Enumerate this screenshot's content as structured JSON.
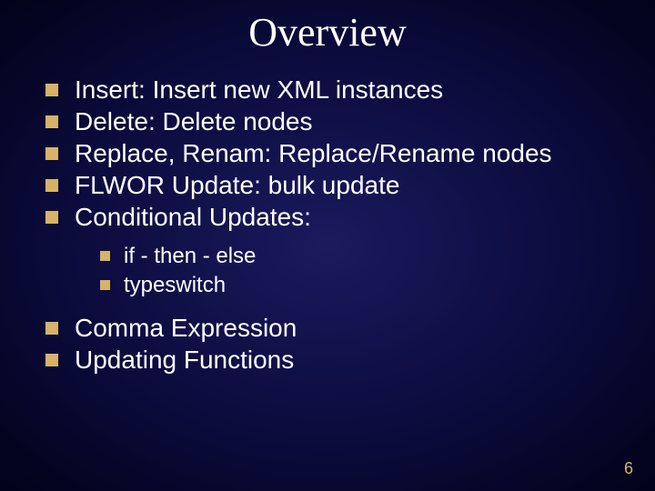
{
  "title": "Overview",
  "bullets": {
    "b0": "Insert: Insert new XML instances",
    "b1": "Delete: Delete nodes",
    "b2": "Replace, Renam: Replace/Rename nodes",
    "b3": "FLWOR Update: bulk update",
    "b4": "Conditional Updates:",
    "b5": "Comma Expression",
    "b6": "Updating Functions"
  },
  "sub": {
    "s0": "if - then - else",
    "s1": "typeswitch"
  },
  "page": "6"
}
